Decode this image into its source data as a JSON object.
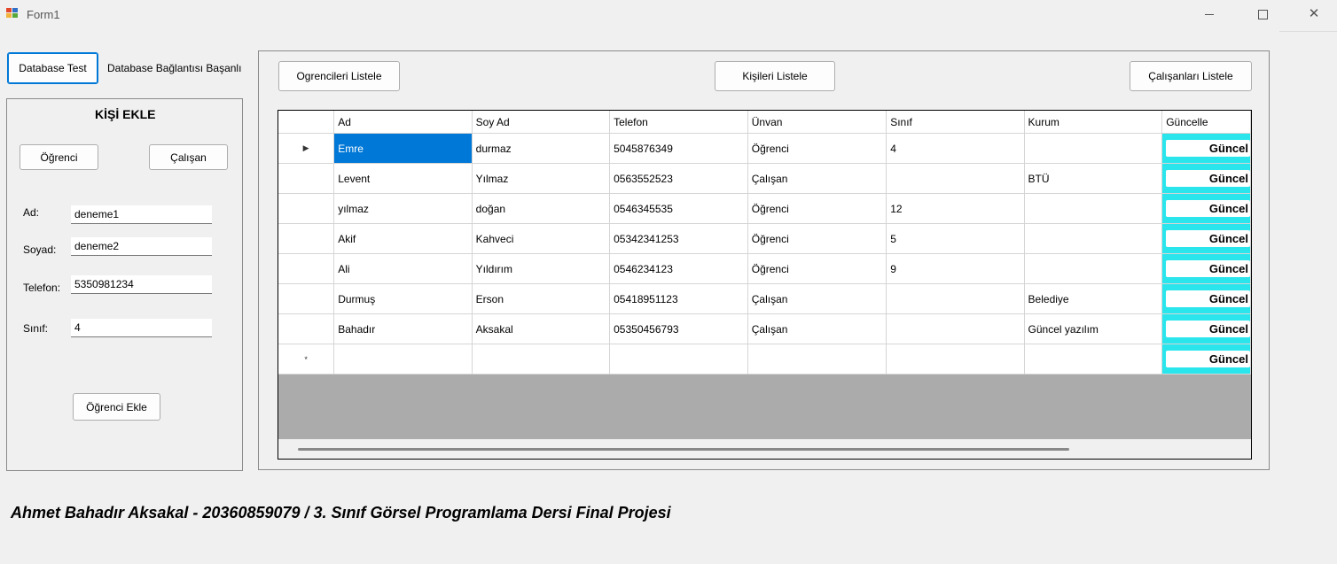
{
  "window": {
    "title": "Form1",
    "minimize_glyph": "—",
    "close_glyph": "✕"
  },
  "top": {
    "db_test_button": "Database Test",
    "db_status": "Database Bağlantısı Başanlı"
  },
  "add_person": {
    "title": "KİŞİ EKLE",
    "student_button": "Öğrenci",
    "employee_button": "Çalışan",
    "fields": {
      "ad_label": "Ad:",
      "ad_value": "deneme1",
      "soyad_label": "Soyad:",
      "soyad_value": "deneme2",
      "telefon_label": "Telefon:",
      "telefon_value": "5350981234",
      "sinif_label": "Sınıf:",
      "sinif_value": "4"
    },
    "submit_button": "Öğrenci Ekle"
  },
  "list_panel": {
    "students_button": "Ogrencileri Listele",
    "people_button": "Kişileri Listele",
    "employees_button": "Çalışanları Listele"
  },
  "grid": {
    "columns": [
      "Ad",
      "Soy Ad",
      "Telefon",
      "Ünvan",
      "Sınıf",
      "Kurum",
      "Güncelle"
    ],
    "button_label": "Güncel",
    "current_row_glyph": "▶",
    "new_row_glyph": "*",
    "rows": [
      [
        "Emre",
        "durmaz",
        "5045876349",
        "Öğrenci",
        "4",
        ""
      ],
      [
        "Levent",
        "Yılmaz",
        "0563552523",
        "Çalışan",
        "",
        "BTÜ"
      ],
      [
        "yılmaz",
        "doğan",
        "0546345535",
        "Öğrenci",
        "12",
        ""
      ],
      [
        "Akif",
        "Kahveci",
        "05342341253",
        "Öğrenci",
        "5",
        ""
      ],
      [
        "Ali",
        "Yıldırım",
        "0546234123",
        "Öğrenci",
        "9",
        ""
      ],
      [
        "Durmuş",
        "Erson",
        "05418951123",
        "Çalışan",
        "",
        "Belediye"
      ],
      [
        "Bahadır",
        "Aksakal",
        "05350456793",
        "Çalışan",
        "",
        "Güncel yazılım"
      ]
    ]
  },
  "footer": "Ahmet Bahadır Aksakal - 20360859079 / 3. Sınıf Görsel Programlama Dersi Final Projesi",
  "colors": {
    "selection": "#0078d7",
    "grid_button_cell": "#2ae6ec",
    "grid_background": "#ababab"
  }
}
